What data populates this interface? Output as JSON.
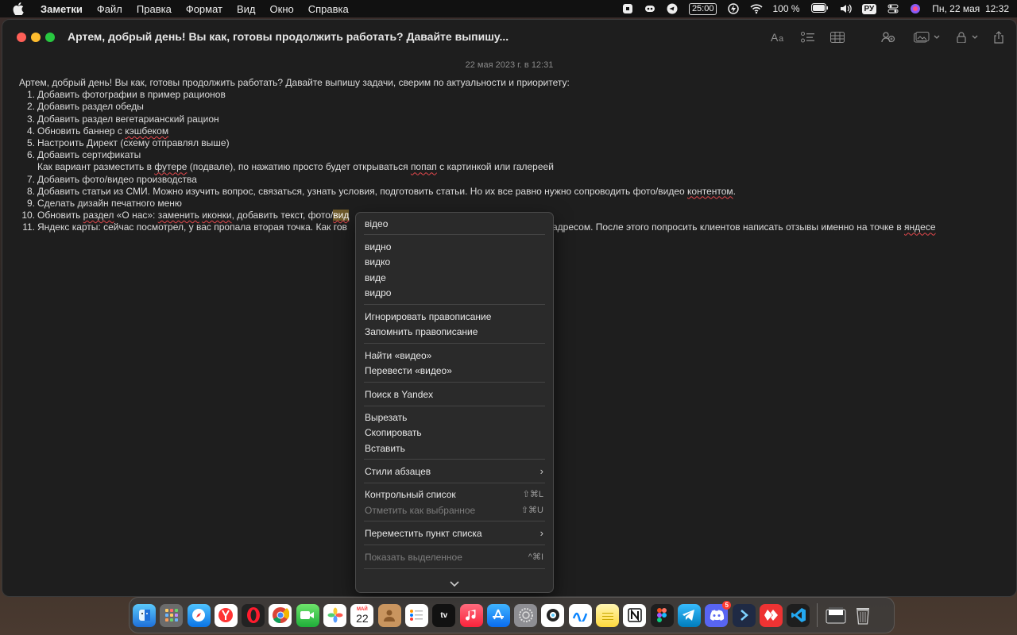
{
  "menubar": {
    "app": "Заметки",
    "items": [
      "Файл",
      "Правка",
      "Формат",
      "Вид",
      "Окно",
      "Справка"
    ],
    "timer": "25:00",
    "battery": "100 %",
    "input_lang": "РУ",
    "datetime": "Пн, 22 мая  12:32"
  },
  "window": {
    "title": "Артем, добрый день! Вы как, готовы продолжить работать? Давайте выпишу...",
    "date": "22 мая 2023 г. в 12:31"
  },
  "note": {
    "intro": "Артем, добрый день! Вы как, готовы продолжить работать? Давайте выпишу задачи, сверим по актуальности и приоритету:",
    "items": [
      {
        "num": "1.",
        "text": "Добавить фотографии в пример рационов"
      },
      {
        "num": "2.",
        "text": "Добавить раздел обеды"
      },
      {
        "num": "3.",
        "text": "Добавить раздел вегетарианский рацион"
      },
      {
        "num": "4.",
        "text_a": "Обновить баннер с ",
        "misspelled": "кэшбеком"
      },
      {
        "num": "5.",
        "text": "Настроить Директ (схему отправлял выше)"
      },
      {
        "num": "6.",
        "text": "Добавить сертификаты"
      },
      {
        "sub_a": "Как вариант разместить в ",
        "sub_b": "футере",
        "sub_c": " (подвале), по нажатию просто будет открываться ",
        "sub_d": "попап",
        "sub_e": " с картинкой или галереей"
      },
      {
        "num": "7.",
        "text": "Добавить фото/видео производства"
      },
      {
        "num": "8.",
        "text_a": "Добавить статьи из СМИ. Можно изучить вопрос, связаться, узнать условия, подготовить статьи. Но их все равно нужно сопроводить фото/видео ",
        "misspelled": "контентом",
        "text_b": "."
      },
      {
        "num": "9.",
        "text": "Сделать дизайн печатного меню"
      },
      {
        "num": "10.",
        "a": "Обновить ",
        "b": "раздел",
        "c": " «О нас»: ",
        "d": "заменить",
        "e": " ",
        "f": "иконки",
        "g": ", добавить текст, фото/",
        "sel": "вид"
      },
      {
        "num": "11.",
        "a": "Яндекс карты: сейчас посмотрел, у вас пропала вторая точка. Как гов",
        "b": "адресом. После этого попросить клиентов написать отзывы именно на точке в ",
        "c": "яндесе"
      }
    ]
  },
  "context_menu": {
    "suggestion_top": "відео",
    "suggestions": [
      "видно",
      "видко",
      "виде",
      "видро"
    ],
    "ignore": "Игнорировать правописание",
    "learn": "Запомнить правописание",
    "find": "Найти «видео»",
    "translate": "Перевести «видео»",
    "search_yandex": "Поиск в Yandex",
    "cut": "Вырезать",
    "copy": "Скопировать",
    "paste": "Вставить",
    "paragraph_styles": "Стили абзацев",
    "checklist": "Контрольный список",
    "checklist_sc": "⇧⌘L",
    "mark_checked": "Отметить как выбранное",
    "mark_checked_sc": "⇧⌘U",
    "move_item": "Переместить пункт списка",
    "show_highlight": "Показать выделенное",
    "show_highlight_sc": "^⌘I"
  },
  "dock": {
    "calendar_month": "МАЙ",
    "calendar_day": "22",
    "discord_badge": "5"
  }
}
